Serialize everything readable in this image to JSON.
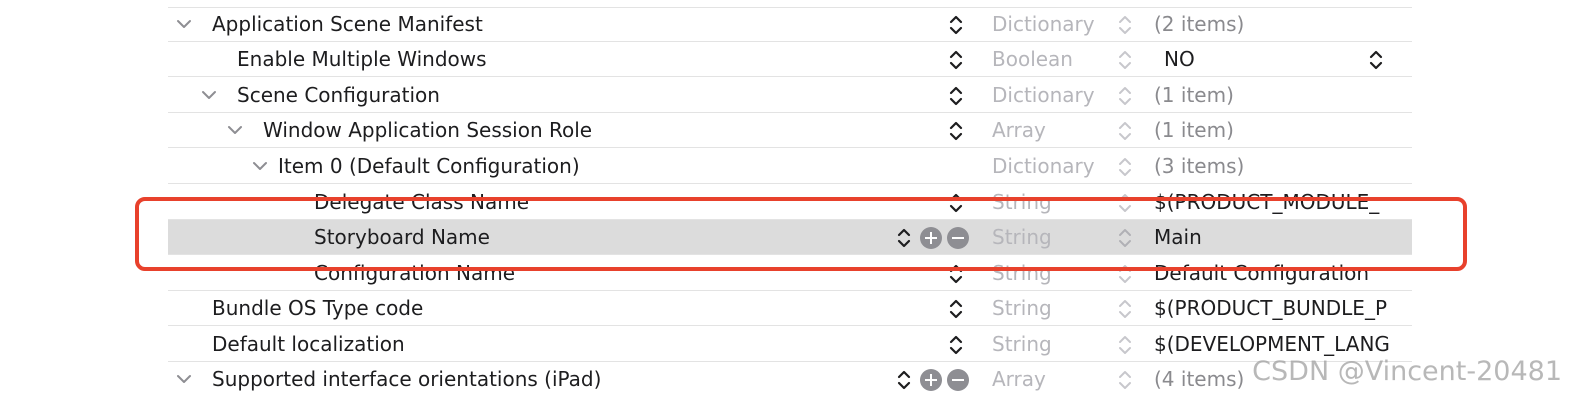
{
  "rows": [
    {
      "key": "Application Scene Manifest",
      "type": "Dictionary",
      "value": "(2 items)"
    },
    {
      "key": "Enable Multiple Windows",
      "type": "Boolean",
      "value": "NO"
    },
    {
      "key": "Scene Configuration",
      "type": "Dictionary",
      "value": "(1 item)"
    },
    {
      "key": "Window Application Session Role",
      "type": "Array",
      "value": "(1 item)"
    },
    {
      "key": "Item 0 (Default Configuration)",
      "type": "Dictionary",
      "value": "(3 items)"
    },
    {
      "key": "Delegate Class Name",
      "type": "String",
      "value": "$(PRODUCT_MODULE_"
    },
    {
      "key": "Storyboard Name",
      "type": "String",
      "value": "Main"
    },
    {
      "key": "Configuration Name",
      "type": "String",
      "value": "Default Configuration"
    },
    {
      "key": "Bundle OS Type code",
      "type": "String",
      "value": "$(PRODUCT_BUNDLE_P"
    },
    {
      "key": "Default localization",
      "type": "String",
      "value": "$(DEVELOPMENT_LANG"
    },
    {
      "key": "Supported interface orientations (iPad)",
      "type": "Array",
      "value": "(4 items)"
    }
  ],
  "highlight_color": "#e8412c",
  "selected_row_color": "#dcdcdc",
  "watermark": "CSDN @Vincent-20481",
  "icons": {
    "disclosure": "chevron-down-icon",
    "stepper": "up-down-stepper-icon",
    "add": "plus-circle-icon",
    "remove": "minus-circle-icon"
  }
}
